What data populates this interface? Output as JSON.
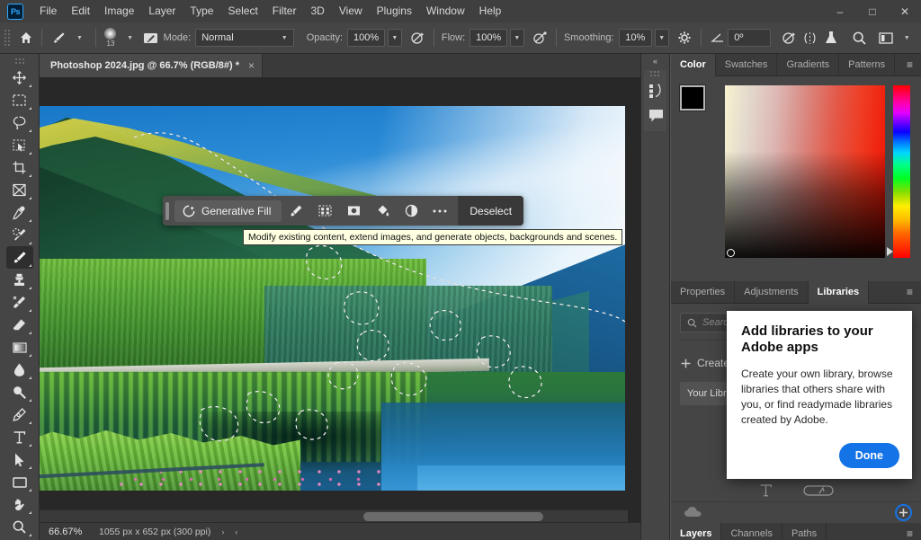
{
  "app": {
    "name": "Adobe Photoshop",
    "logo_text": "Ps"
  },
  "menubar": {
    "items": [
      "File",
      "Edit",
      "Image",
      "Layer",
      "Type",
      "Select",
      "Filter",
      "3D",
      "View",
      "Plugins",
      "Window",
      "Help"
    ]
  },
  "window_controls": {
    "minimize": "–",
    "maximize": "□",
    "close": "✕"
  },
  "options_bar": {
    "home_icon": "home-icon",
    "brush_preset_icon": "brush-icon",
    "brush_size": "13",
    "airbrush_icon": "airbrush-toggle-icon",
    "mode_label": "Mode:",
    "mode_value": "Normal",
    "opacity_label": "Opacity:",
    "opacity_value": "100%",
    "opacity_pressure_icon": "pressure-opacity-icon",
    "flow_label": "Flow:",
    "flow_value": "100%",
    "flow_pressure_icon": "airbrush-flow-icon",
    "smoothing_label": "Smoothing:",
    "smoothing_value": "10%",
    "smoothing_settings_icon": "gear-icon",
    "angle_icon": "angle-icon",
    "angle_value": "0º",
    "tablet_pressure_size_icon": "tablet-pressure-size-icon",
    "symmetry_icon": "symmetry-icon",
    "flask_icon": "flask-icon",
    "search_icon": "search-icon",
    "workspace_icon": "workspace-icon"
  },
  "document_tab": {
    "title": "Photoshop 2024.jpg @ 66.7% (RGB/8#) *",
    "close_glyph": "×"
  },
  "toolbar": {
    "tools": [
      {
        "name": "move-tool",
        "icon": "move-icon",
        "selected": false
      },
      {
        "name": "rectangular-marquee-tool",
        "icon": "marquee-icon",
        "selected": false
      },
      {
        "name": "lasso-tool",
        "icon": "lasso-icon",
        "selected": false
      },
      {
        "name": "object-selection-tool",
        "icon": "quick-selection-icon",
        "selected": false
      },
      {
        "name": "crop-tool",
        "icon": "crop-icon",
        "selected": false
      },
      {
        "name": "frame-tool",
        "icon": "frame-icon",
        "selected": false
      },
      {
        "name": "eyedropper-tool",
        "icon": "eyedropper-icon",
        "selected": false
      },
      {
        "name": "spot-healing-brush-tool",
        "icon": "healing-brush-icon",
        "selected": false
      },
      {
        "name": "brush-tool",
        "icon": "brush-icon",
        "selected": true
      },
      {
        "name": "clone-stamp-tool",
        "icon": "clone-stamp-icon",
        "selected": false
      },
      {
        "name": "history-brush-tool",
        "icon": "history-brush-icon",
        "selected": false
      },
      {
        "name": "eraser-tool",
        "icon": "eraser-icon",
        "selected": false
      },
      {
        "name": "gradient-tool",
        "icon": "gradient-icon",
        "selected": false
      },
      {
        "name": "blur-tool",
        "icon": "blur-drop-icon",
        "selected": false
      },
      {
        "name": "dodge-tool",
        "icon": "dodge-icon",
        "selected": false
      },
      {
        "name": "pen-tool",
        "icon": "pen-icon",
        "selected": false
      },
      {
        "name": "type-tool",
        "icon": "type-t-icon",
        "selected": false
      },
      {
        "name": "path-selection-tool",
        "icon": "path-arrow-icon",
        "selected": false
      },
      {
        "name": "rectangle-tool",
        "icon": "rectangle-icon",
        "selected": false
      },
      {
        "name": "hand-tool",
        "icon": "hand-icon",
        "selected": false
      },
      {
        "name": "zoom-tool",
        "icon": "magnifier-icon",
        "selected": false
      }
    ]
  },
  "generative_taskbar": {
    "drag_handle": "drag-handle",
    "primary_label": "Generative Fill",
    "primary_icon": "generative-ai-icon",
    "actions": [
      {
        "name": "select-subject-button",
        "icon": "select-subject-icon"
      },
      {
        "name": "select-and-mask-button",
        "icon": "select-and-mask-icon"
      },
      {
        "name": "add-mask-button",
        "icon": "add-layer-mask-icon"
      },
      {
        "name": "fill-selection-button",
        "icon": "paint-bucket-icon"
      },
      {
        "name": "adjustment-layer-button",
        "icon": "adjustment-layer-icon"
      },
      {
        "name": "more-options-button",
        "icon": "ellipsis-icon"
      }
    ],
    "deselect_label": "Deselect",
    "tooltip": "Modify existing content, extend images, and generate objects, backgrounds and scenes."
  },
  "rail": {
    "collapse_glyph": "«",
    "icons": [
      {
        "name": "history-panel-icon",
        "label": "history-icon"
      },
      {
        "name": "comments-panel-icon",
        "label": "comment-icon"
      }
    ]
  },
  "color_panel": {
    "tabs": [
      "Color",
      "Swatches",
      "Gradients",
      "Patterns"
    ],
    "active_tab": "Color",
    "menu_glyph": "≡",
    "foreground_color": "#000000",
    "background_color": "#ffffff"
  },
  "libraries_panel": {
    "tabs": [
      "Properties",
      "Adjustments",
      "Libraries"
    ],
    "active_tab": "Libraries",
    "menu_glyph": "≡",
    "search_placeholder": "Search",
    "search_icon": "search-icon",
    "create_label": "Create new library",
    "create_icon": "plus-icon",
    "library_dropdown_value": "Your Library",
    "dropdown_caret": "⌄",
    "footer_icons": [
      "type-t-icon",
      "link-icon"
    ]
  },
  "libraries_popover": {
    "title": "Add libraries to your Adobe apps",
    "body": "Create your own library, browse libraries that others share with you, or find readymade libraries created by Adobe.",
    "button_label": "Done",
    "button_color": "#1473e6"
  },
  "cloud_strip": {
    "cloud_icon": "cloud-icon",
    "add_icon": "add-library-icon",
    "add_highlight_color": "#1473e6"
  },
  "layers_panel": {
    "tabs": [
      "Layers",
      "Channels",
      "Paths"
    ],
    "active_tab": "Layers",
    "menu_glyph": "≡"
  },
  "status_bar": {
    "zoom": "66.67%",
    "doc_size": "1055 px x 652 px (300 ppi)",
    "expand_glyph": "›",
    "collapse_glyph": "‹"
  },
  "canvas": {
    "image_description": "Mountain lake landscape with forested hillside and reflections",
    "selection_active": true
  }
}
